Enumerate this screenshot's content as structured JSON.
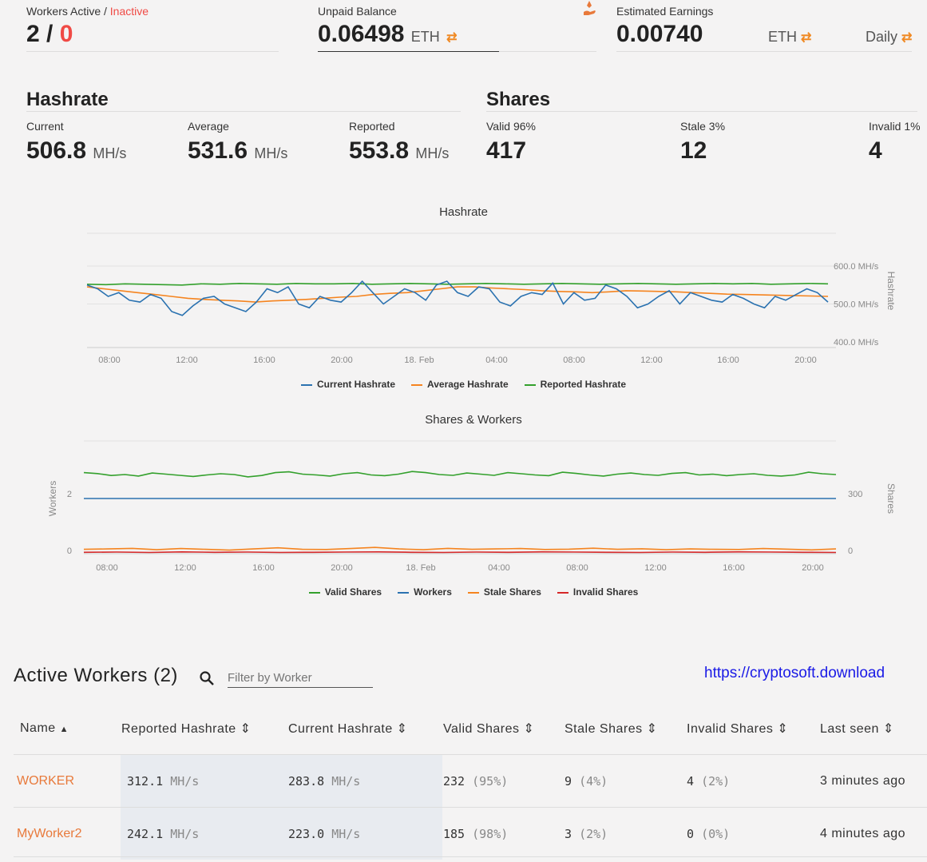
{
  "stats": {
    "workers": {
      "label": "Workers Active",
      "sep": " / ",
      "inactive_label": "Inactive",
      "active": "2",
      "slash": " / ",
      "inactive": "0"
    },
    "unpaid": {
      "label": "Unpaid Balance",
      "value": "0.06498",
      "unit": "ETH",
      "swap": "⇄"
    },
    "estimated": {
      "label": "Estimated Earnings",
      "value": "0.00740",
      "unit": "ETH",
      "swap": "⇄",
      "period": "Daily",
      "period_swap": "⇄"
    }
  },
  "hashrate": {
    "title": "Hashrate",
    "current": {
      "label": "Current",
      "value": "506.8",
      "unit": "MH/s"
    },
    "average": {
      "label": "Average",
      "value": "531.6",
      "unit": "MH/s"
    },
    "reported": {
      "label": "Reported",
      "value": "553.8",
      "unit": "MH/s"
    }
  },
  "shares": {
    "title": "Shares",
    "valid": {
      "label": "Valid 96%",
      "value": "417"
    },
    "stale": {
      "label": "Stale 3%",
      "value": "12"
    },
    "invalid": {
      "label": "Invalid 1%",
      "value": "4"
    }
  },
  "colors": {
    "blue": "#2b72b0",
    "orange": "#f5841f",
    "green": "#33a02c",
    "red": "#d62728",
    "accent": "#e8793a"
  },
  "chart_data": [
    {
      "type": "line",
      "title": "Hashrate",
      "ylabel": "Hashrate",
      "x_ticks": [
        "08:00",
        "12:00",
        "16:00",
        "20:00",
        "18. Feb",
        "04:00",
        "08:00",
        "12:00",
        "16:00",
        "20:00"
      ],
      "y_ticks": [
        "600.0 MH/s",
        "500.0 MH/s",
        "400.0 MH/s"
      ],
      "ylim": [
        400,
        600
      ],
      "legend": [
        "Current Hashrate",
        "Average Hashrate",
        "Reported Hashrate"
      ],
      "legend_position": "bottom",
      "series": [
        {
          "name": "Current Hashrate",
          "values": [
            550,
            540,
            520,
            530,
            510,
            505,
            525,
            515,
            480,
            470,
            495,
            515,
            520,
            500,
            490,
            480,
            505,
            540,
            530,
            545,
            500,
            490,
            520,
            510,
            505,
            530,
            560,
            530,
            500,
            520,
            540,
            530,
            510,
            550,
            560,
            530,
            520,
            545,
            540,
            505,
            495,
            520,
            530,
            525,
            555,
            500,
            530,
            510,
            515,
            550,
            540,
            520,
            490,
            500,
            520,
            535,
            500,
            530,
            520,
            510,
            505,
            525,
            515,
            500,
            490,
            520,
            510,
            525,
            540,
            530,
            505
          ]
        },
        {
          "name": "Average Hashrate",
          "values": [
            545,
            540,
            535,
            530,
            525,
            520,
            515,
            512,
            510,
            508,
            505,
            508,
            510,
            512,
            515,
            518,
            520,
            525,
            528,
            530,
            535,
            540,
            545,
            545,
            542,
            540,
            538,
            535,
            533,
            532,
            530,
            532,
            535,
            534,
            533,
            532,
            530,
            528,
            526,
            525,
            524,
            523,
            522,
            521,
            520
          ]
        },
        {
          "name": "Reported Hashrate",
          "values": [
            552,
            551,
            553,
            552,
            551,
            550,
            553,
            552,
            554,
            553,
            552,
            554,
            553,
            553,
            554,
            552,
            553,
            554,
            553,
            552,
            553,
            554,
            553,
            552,
            553,
            554,
            553,
            552,
            553,
            554,
            553,
            552,
            553,
            554,
            553,
            554,
            552,
            553,
            554,
            553
          ]
        }
      ]
    },
    {
      "type": "line",
      "title": "Shares & Workers",
      "ylabel_left": "Workers",
      "ylabel_right": "Shares",
      "x_ticks": [
        "08:00",
        "12:00",
        "16:00",
        "20:00",
        "18. Feb",
        "04:00",
        "08:00",
        "12:00",
        "16:00",
        "20:00"
      ],
      "y_ticks_left": [
        "2",
        "0"
      ],
      "y_ticks_right": [
        "300",
        "0"
      ],
      "legend": [
        "Valid Shares",
        "Workers",
        "Stale Shares",
        "Invalid Shares"
      ],
      "legend_position": "bottom",
      "series": [
        {
          "name": "Valid Shares",
          "values": [
            410,
            405,
            395,
            400,
            392,
            408,
            402,
            396,
            390,
            398,
            404,
            400,
            388,
            395,
            410,
            414,
            402,
            398,
            392,
            404,
            410,
            398,
            394,
            402,
            416,
            410,
            400,
            396,
            408,
            402,
            396,
            410,
            404,
            398,
            394,
            412,
            406,
            398,
            392,
            402,
            408,
            400,
            396,
            406,
            410,
            398,
            402,
            394,
            400,
            404,
            396,
            392,
            398,
            412,
            404,
            400
          ]
        },
        {
          "name": "Workers",
          "values": [
            2,
            2,
            2,
            2,
            2,
            2,
            2,
            2,
            2,
            2,
            2,
            2,
            2,
            2,
            2,
            2,
            2,
            2,
            2,
            2,
            2,
            2
          ]
        },
        {
          "name": "Stale Shares",
          "values": [
            10,
            12,
            15,
            8,
            14,
            10,
            6,
            12,
            18,
            10,
            9,
            14,
            20,
            12,
            8,
            15,
            10,
            12,
            14,
            9,
            11,
            16,
            10,
            13,
            8,
            12,
            10,
            9,
            14,
            11,
            7,
            12
          ]
        },
        {
          "name": "Invalid Shares",
          "values": [
            3,
            4,
            2,
            5,
            3,
            4,
            2,
            3,
            4,
            5,
            3,
            2,
            4,
            3,
            5,
            4,
            3,
            2,
            4,
            3,
            5,
            4,
            3,
            2
          ]
        }
      ]
    }
  ],
  "workers_table": {
    "title": "Active Workers",
    "count": "(2)",
    "filter_placeholder": "Filter by Worker",
    "link": "https://cryptosoft.download",
    "columns": [
      "Name",
      "Reported Hashrate",
      "Current Hashrate",
      "Valid Shares",
      "Stale Shares",
      "Invalid Shares",
      "Last seen"
    ],
    "sort_icons": [
      "▲",
      "⇕",
      "⇕",
      "⇕",
      "⇕",
      "⇕",
      "⇕"
    ],
    "rows": [
      {
        "name": "WORKER",
        "reported": "312.1",
        "reported_unit": "MH/s",
        "current": "283.8",
        "current_unit": "MH/s",
        "valid": "232",
        "valid_pct": "(95%)",
        "stale": "9",
        "stale_pct": "(4%)",
        "invalid": "4",
        "invalid_pct": "(2%)",
        "last_seen": "3 minutes ago"
      },
      {
        "name": "MyWorker2",
        "reported": "242.1",
        "reported_unit": "MH/s",
        "current": "223.0",
        "current_unit": "MH/s",
        "valid": "185",
        "valid_pct": "(98%)",
        "stale": "3",
        "stale_pct": "(2%)",
        "invalid": "0",
        "invalid_pct": "(0%)",
        "last_seen": "4 minutes ago"
      }
    ]
  }
}
